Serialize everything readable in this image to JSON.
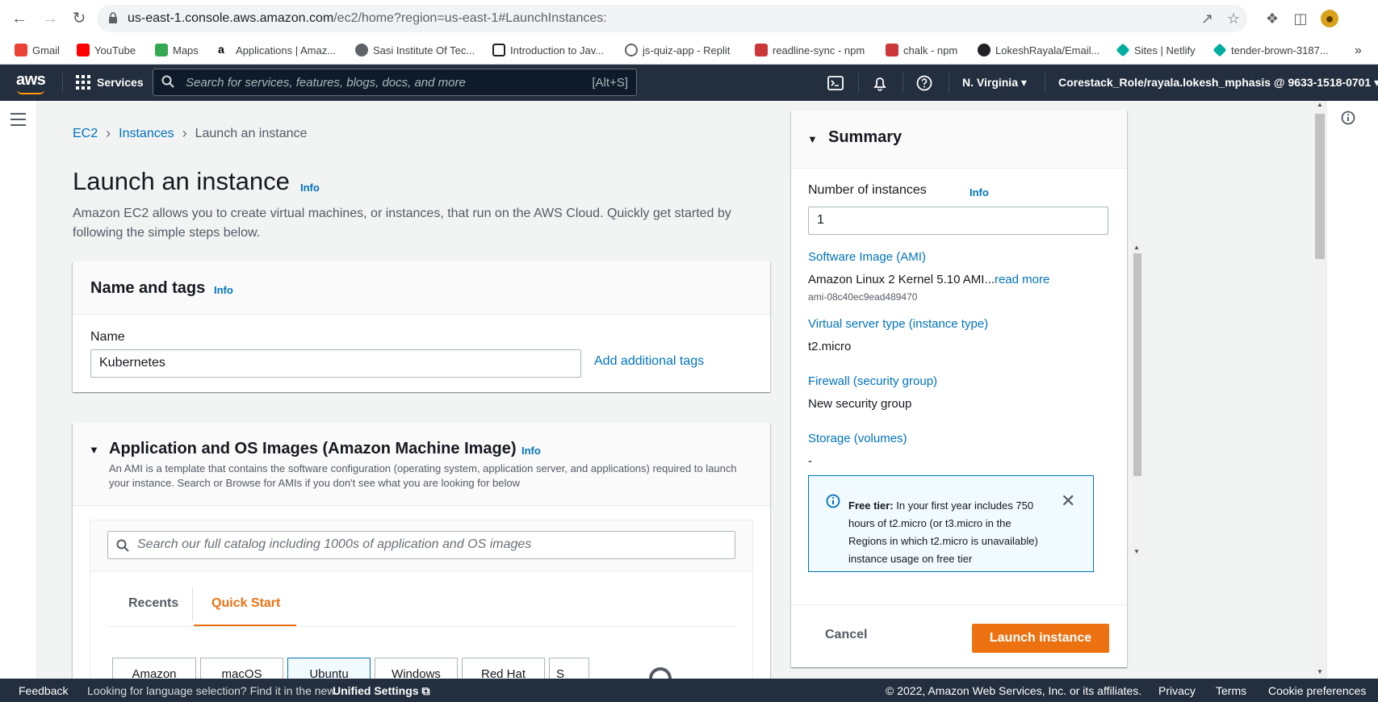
{
  "browser": {
    "url_host": "us-east-1.console.aws.amazon.com",
    "url_path": "/ec2/home?region=us-east-1#LaunchInstances:",
    "bookmarks": [
      {
        "label": "Gmail",
        "color": "#ea4335"
      },
      {
        "label": "YouTube",
        "color": "#ff0000"
      },
      {
        "label": "Maps",
        "color": "#34a853"
      },
      {
        "label": "Applications | Amaz...",
        "color": "#ff9900"
      },
      {
        "label": "Sasi Institute Of Tec...",
        "color": "#5f6368"
      },
      {
        "label": "Introduction to Jav...",
        "color": "#202124"
      },
      {
        "label": "js-quiz-app - Replit",
        "color": "#5f6368"
      },
      {
        "label": "readline-sync - npm",
        "color": "#cb3837"
      },
      {
        "label": "chalk - npm",
        "color": "#cb3837"
      },
      {
        "label": "LokeshRayala/Email...",
        "color": "#202124"
      },
      {
        "label": "Sites | Netlify",
        "color": "#00ad9f"
      },
      {
        "label": "tender-brown-3187...",
        "color": "#00ad9f"
      }
    ],
    "overflow": "»"
  },
  "awsnav": {
    "logo": "aws",
    "services_label": "Services",
    "search_placeholder": "Search for services, features, blogs, docs, and more",
    "search_shortcut": "[Alt+S]",
    "region": "N. Virginia",
    "account": "Corestack_Role/rayala.lokesh_mphasis @ 9633-1518-0701"
  },
  "breadcrumb": {
    "items": [
      "EC2",
      "Instances",
      "Launch an instance"
    ]
  },
  "page": {
    "title": "Launch an instance",
    "info": "Info",
    "description": "Amazon EC2 allows you to create virtual machines, or instances, that run on the AWS Cloud. Quickly get started by following the simple steps below."
  },
  "name_tags": {
    "heading": "Name and tags",
    "info": "Info",
    "name_label": "Name",
    "name_value": "Kubernetes",
    "add_tags": "Add additional tags"
  },
  "ami": {
    "heading": "Application and OS Images (Amazon Machine Image)",
    "info": "Info",
    "description": "An AMI is a template that contains the software configuration (operating system, application server, and applications) required to launch your instance. Search or Browse for AMIs if you don't see what you are looking for below",
    "search_placeholder": "Search our full catalog including 1000s of application and OS images",
    "tabs": [
      "Recents",
      "Quick Start"
    ],
    "active_tab": "Quick Start",
    "tiles": [
      "Amazon",
      "macOS",
      "Ubuntu",
      "Windows",
      "Red Hat",
      "S"
    ]
  },
  "summary": {
    "heading": "Summary",
    "num_label": "Number of instances",
    "info": "Info",
    "num_value": "1",
    "ami_title": "Software Image (AMI)",
    "ami_value": "Amazon Linux 2 Kernel 5.10 AMI...",
    "ami_readmore": "read more",
    "ami_id": "ami-08c40ec9ead489470",
    "type_title": "Virtual server type (instance type)",
    "type_value": "t2.micro",
    "firewall_title": "Firewall (security group)",
    "firewall_value": "New security group",
    "storage_title": "Storage (volumes)",
    "storage_value": "-",
    "freetier_bold": "Free tier:",
    "freetier_text": " In your first year includes 750 hours of t2.micro (or t3.micro in the Regions in which t2.micro is unavailable) instance usage on free tier",
    "cancel": "Cancel",
    "launch": "Launch instance"
  },
  "footer": {
    "feedback": "Feedback",
    "lang_text": "Looking for language selection? Find it in the new",
    "unified": "Unified Settings",
    "copyright": "© 2022, Amazon Web Services, Inc. or its affiliates.",
    "privacy": "Privacy",
    "terms": "Terms",
    "cookies": "Cookie preferences"
  },
  "colors": {
    "aws_nav": "#232f3e",
    "link": "#0073bb",
    "accent": "#ec7211"
  }
}
